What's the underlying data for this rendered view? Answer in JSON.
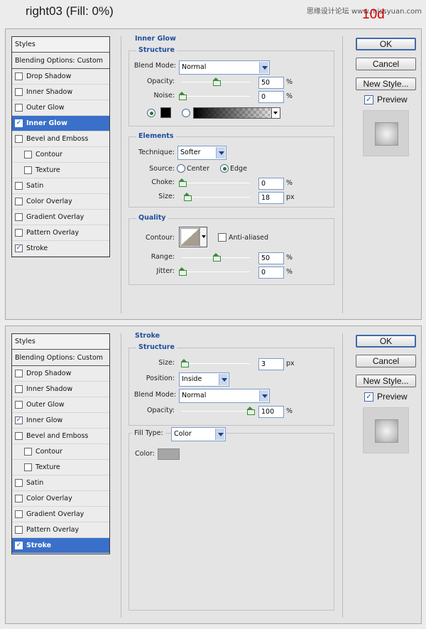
{
  "header": {
    "title": "right03   (Fill: 0%)",
    "watermark": "思缘设计论坛 www.missyuan.com",
    "step": "10d"
  },
  "icons": {
    "checkbox_checked": "check-icon",
    "dropdown": "chevron-down-icon"
  },
  "colors": {
    "selected_row": "#3a70c9",
    "group_title": "#1f4e9c",
    "slider_thumb": "#3d8a3d",
    "glow_color": "#000000",
    "stroke_color": "#a6a6a6"
  },
  "buttons": {
    "ok": "OK",
    "cancel": "Cancel",
    "new_style": "New Style...",
    "preview": "Preview",
    "preview_checked": true
  },
  "dialog1": {
    "styles": [
      {
        "label": "Styles",
        "kind": "head"
      },
      {
        "label": "Blending Options: Custom",
        "kind": "blend"
      },
      {
        "label": "Drop Shadow",
        "checked": false
      },
      {
        "label": "Inner Shadow",
        "checked": false
      },
      {
        "label": "Outer Glow",
        "checked": false
      },
      {
        "label": "Inner Glow",
        "checked": true,
        "selected": true
      },
      {
        "label": "Bevel and Emboss",
        "checked": false
      },
      {
        "label": "Contour",
        "checked": false,
        "indent": true
      },
      {
        "label": "Texture",
        "checked": false,
        "indent": true
      },
      {
        "label": "Satin",
        "checked": false
      },
      {
        "label": "Color Overlay",
        "checked": false
      },
      {
        "label": "Gradient Overlay",
        "checked": false
      },
      {
        "label": "Pattern Overlay",
        "checked": false
      },
      {
        "label": "Stroke",
        "checked": true
      }
    ],
    "panel_title": "Inner Glow",
    "structure": {
      "title": "Structure",
      "blend_mode_label": "Blend Mode:",
      "blend_mode": "Normal",
      "opacity_label": "Opacity:",
      "opacity": "50",
      "opacity_pct": 0.5,
      "noise_label": "Noise:",
      "noise": "0",
      "noise_pct": 0.0,
      "unit": "%"
    },
    "elements": {
      "title": "Elements",
      "technique_label": "Technique:",
      "technique": "Softer",
      "source_label": "Source:",
      "source_center": "Center",
      "source_edge": "Edge",
      "choke_label": "Choke:",
      "choke": "0",
      "choke_pct": 0.0,
      "choke_unit": "%",
      "size_label": "Size:",
      "size": "18",
      "size_frac": 0.07,
      "size_unit": "px"
    },
    "quality": {
      "title": "Quality",
      "contour_label": "Contour:",
      "anti_aliased": "Anti-aliased",
      "range_label": "Range:",
      "range": "50",
      "range_pct": 0.5,
      "range_unit": "%",
      "jitter_label": "Jitter:",
      "jitter": "0",
      "jitter_pct": 0.0,
      "jitter_unit": "%"
    }
  },
  "dialog2": {
    "styles": [
      {
        "label": "Styles",
        "kind": "head"
      },
      {
        "label": "Blending Options: Custom",
        "kind": "blend"
      },
      {
        "label": "Drop Shadow",
        "checked": false
      },
      {
        "label": "Inner Shadow",
        "checked": false
      },
      {
        "label": "Outer Glow",
        "checked": false
      },
      {
        "label": "Inner Glow",
        "checked": true
      },
      {
        "label": "Bevel and Emboss",
        "checked": false
      },
      {
        "label": "Contour",
        "checked": false,
        "indent": true
      },
      {
        "label": "Texture",
        "checked": false,
        "indent": true
      },
      {
        "label": "Satin",
        "checked": false
      },
      {
        "label": "Color Overlay",
        "checked": false
      },
      {
        "label": "Gradient Overlay",
        "checked": false
      },
      {
        "label": "Pattern Overlay",
        "checked": false
      },
      {
        "label": "Stroke",
        "checked": true,
        "selected": true
      }
    ],
    "panel_title": "Stroke",
    "structure": {
      "title": "Structure",
      "size_label": "Size:",
      "size": "3",
      "size_frac": 0.03,
      "size_unit": "px",
      "position_label": "Position:",
      "position": "Inside",
      "blend_mode_label": "Blend Mode:",
      "blend_mode": "Normal",
      "opacity_label": "Opacity:",
      "opacity": "100",
      "opacity_pct": 1.0,
      "opacity_unit": "%"
    },
    "fill": {
      "fill_type_label": "Fill Type:",
      "fill_type": "Color",
      "color_label": "Color:"
    }
  }
}
